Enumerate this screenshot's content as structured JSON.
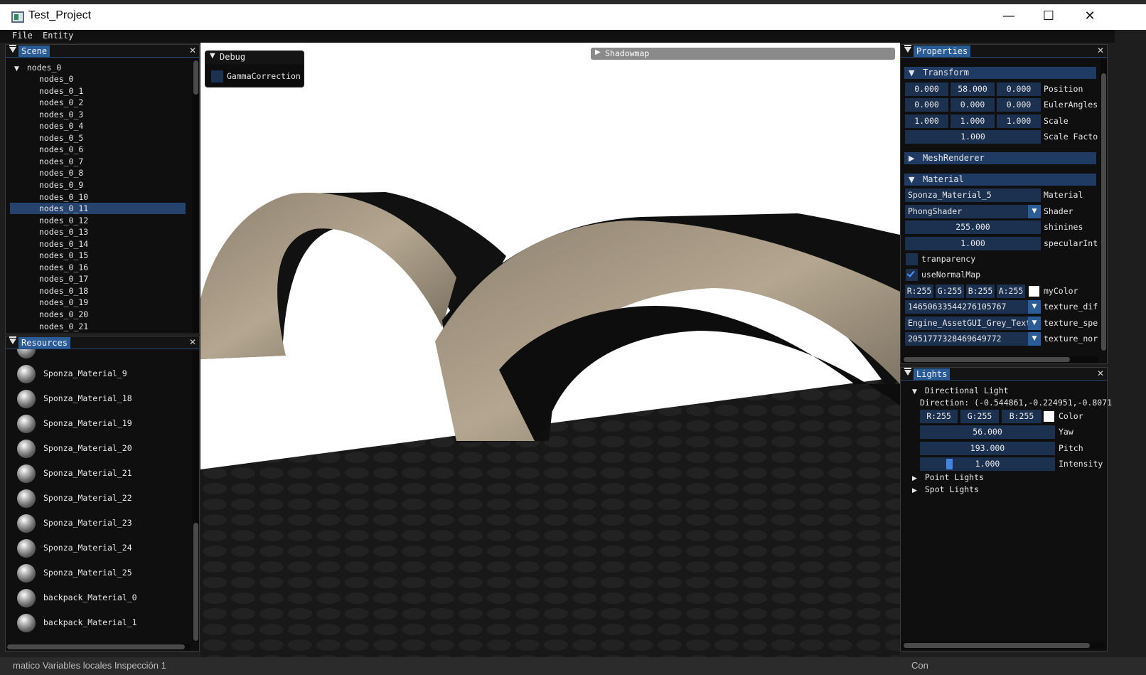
{
  "window": {
    "title": "Test_Project",
    "minimize": "—",
    "maximize": "☐",
    "close": "✕"
  },
  "menu": [
    "File",
    "Entity"
  ],
  "scene": {
    "tab": "Scene",
    "root": "nodes_0",
    "nodes": [
      "nodes_0",
      "nodes_0_1",
      "nodes_0_2",
      "nodes_0_3",
      "nodes_0_4",
      "nodes_0_5",
      "nodes_0_6",
      "nodes_0_7",
      "nodes_0_8",
      "nodes_0_9",
      "nodes_0_10",
      "nodes_0_11",
      "nodes_0_12",
      "nodes_0_13",
      "nodes_0_14",
      "nodes_0_15",
      "nodes_0_16",
      "nodes_0_17",
      "nodes_0_18",
      "nodes_0_19",
      "nodes_0_20",
      "nodes_0_21"
    ],
    "selected": "nodes_0_11"
  },
  "debug": {
    "title": "Debug",
    "gamma_label": "GammaCorrection"
  },
  "shadowmap": {
    "title": "Shadowmap"
  },
  "resources": {
    "tab": "Resources",
    "items": [
      "Sponza_Material_9",
      "Sponza_Material_18",
      "Sponza_Material_19",
      "Sponza_Material_20",
      "Sponza_Material_21",
      "Sponza_Material_22",
      "Sponza_Material_23",
      "Sponza_Material_24",
      "Sponza_Material_25",
      "backpack_Material_0",
      "backpack_Material_1"
    ]
  },
  "properties": {
    "tab": "Properties",
    "transform": {
      "header": "Transform",
      "position": [
        "0.000",
        "58.000",
        "0.000"
      ],
      "position_label": "Position",
      "euler": [
        "0.000",
        "0.000",
        "0.000"
      ],
      "euler_label": "EulerAngles",
      "scale": [
        "1.000",
        "1.000",
        "1.000"
      ],
      "scale_label": "Scale",
      "scale_factor": "1.000",
      "scale_factor_label": "Scale Facto"
    },
    "mesh_renderer": {
      "header": "MeshRenderer"
    },
    "material": {
      "header": "Material",
      "name": "Sponza_Material_5",
      "name_label": "Material",
      "shader": "PhongShader",
      "shader_label": "Shader",
      "shininess": "255.000",
      "shininess_label": "shinines",
      "specular": "1.000",
      "specular_label": "specularInt",
      "transparency_label": "tranparency",
      "normal_map_label": "useNormalMap",
      "color": [
        "R:255",
        "G:255",
        "B:255",
        "A:255"
      ],
      "color_label": "myColor",
      "texture_diffuse": "14650633544276105767",
      "texture_diffuse_label": "texture_dif",
      "texture_specular": "Engine_AssetGUI_Grey_Text",
      "texture_specular_label": "texture_spe",
      "texture_normal": "2051777328469649772",
      "texture_normal_label": "texture_nor"
    }
  },
  "lights": {
    "tab": "Lights",
    "directional": "Directional Light",
    "direction": "Direction: (-0.544861,-0.224951,-0.8071",
    "color": [
      "R:255",
      "G:255",
      "B:255"
    ],
    "color_label": "Color",
    "yaw": "56.000",
    "yaw_label": "Yaw",
    "pitch": "193.000",
    "pitch_label": "Pitch",
    "intensity": "1.000",
    "intensity_label": "Intensity",
    "point": "Point Lights",
    "spot": "Spot Lights"
  },
  "bottom": {
    "left": "matico   Variables locales   Inspección 1",
    "right": "Con"
  }
}
